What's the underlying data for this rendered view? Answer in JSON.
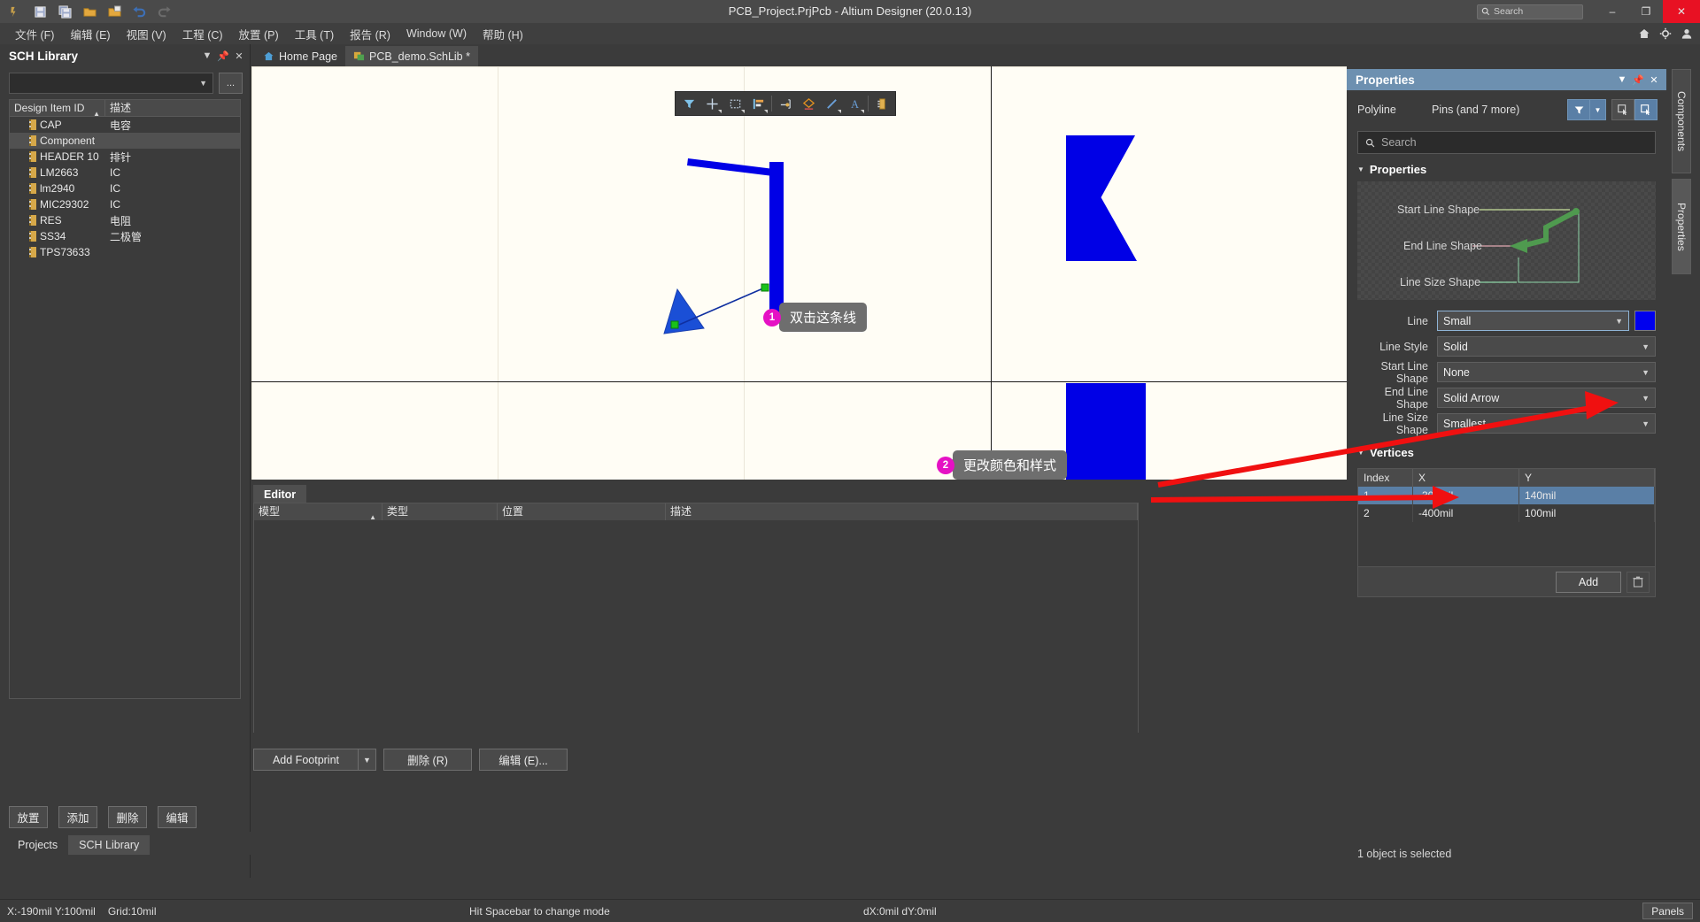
{
  "window": {
    "title": "PCB_Project.PrjPcb - Altium Designer (20.0.13)",
    "search_placeholder": "Search",
    "minimize": "–",
    "maximize": "❐",
    "close": "✕"
  },
  "quick_access": [
    {
      "name": "altium-logo-icon"
    },
    {
      "name": "save-icon"
    },
    {
      "name": "save-all-icon"
    },
    {
      "name": "open-icon"
    },
    {
      "name": "open-project-icon"
    },
    {
      "name": "undo-icon"
    },
    {
      "name": "redo-icon"
    }
  ],
  "menu": {
    "items": [
      {
        "label": "文件 (F)"
      },
      {
        "label": "编辑 (E)"
      },
      {
        "label": "视图 (V)"
      },
      {
        "label": "工程 (C)"
      },
      {
        "label": "放置 (P)"
      },
      {
        "label": "工具 (T)"
      },
      {
        "label": "报告 (R)"
      },
      {
        "label": "Window (W)"
      },
      {
        "label": "帮助 (H)"
      }
    ],
    "right_icons": [
      "home-icon",
      "gear-icon",
      "user-icon"
    ]
  },
  "sch_library": {
    "title": "SCH Library",
    "header_buttons": [
      "chevron-down-icon",
      "pin-icon",
      "close-icon"
    ],
    "combo_value": "",
    "ellipsis_label": "...",
    "columns": [
      "Design Item ID",
      "描述"
    ],
    "rows": [
      {
        "id": "CAP",
        "desc": "电容",
        "selected": false
      },
      {
        "id": "Component",
        "desc": "",
        "selected": true
      },
      {
        "id": "HEADER 10",
        "desc": "排针",
        "selected": false
      },
      {
        "id": "LM2663",
        "desc": "IC",
        "selected": false
      },
      {
        "id": "lm2940",
        "desc": "IC",
        "selected": false
      },
      {
        "id": "MIC29302",
        "desc": "IC",
        "selected": false
      },
      {
        "id": "RES",
        "desc": "电阻",
        "selected": false
      },
      {
        "id": "SS34",
        "desc": "二极管",
        "selected": false
      },
      {
        "id": "TPS73633",
        "desc": "",
        "selected": false
      }
    ],
    "buttons": [
      {
        "label": "放置"
      },
      {
        "label": "添加"
      },
      {
        "label": "删除"
      },
      {
        "label": "编辑"
      }
    ],
    "tabs": [
      {
        "label": "Projects",
        "active": false
      },
      {
        "label": "SCH Library",
        "active": true
      }
    ]
  },
  "document_tabs": [
    {
      "label": "Home Page",
      "icon": "home-icon",
      "active": false
    },
    {
      "label": "PCB_demo.SchLib *",
      "icon": "schlib-icon",
      "active": true
    }
  ],
  "canvas_toolbar": [
    {
      "name": "filter-icon",
      "caret": false
    },
    {
      "name": "crosshair-icon",
      "caret": true
    },
    {
      "name": "select-area-icon",
      "caret": true
    },
    {
      "name": "align-icon",
      "caret": true
    },
    {
      "name": "place-pin-icon",
      "caret": false
    },
    {
      "name": "place-polygon-icon",
      "caret": false
    },
    {
      "name": "place-line-icon",
      "caret": true
    },
    {
      "name": "place-text-icon",
      "caret": true
    },
    {
      "name": "place-component-icon",
      "caret": false
    }
  ],
  "callouts": [
    {
      "number": "1",
      "text": "双击这条线"
    },
    {
      "number": "2",
      "text": "更改颜色和样式"
    }
  ],
  "editor_panel": {
    "tab_label": "Editor",
    "columns": [
      "模型",
      "类型",
      "位置",
      "描述"
    ],
    "rows": [],
    "buttons": [
      {
        "label": "Add Footprint",
        "accel": "A",
        "split": true
      },
      {
        "label": "删除 (R)",
        "split": false
      },
      {
        "label": "编辑 (E)...",
        "split": false
      }
    ]
  },
  "properties_panel": {
    "title": "Properties",
    "header_buttons": [
      "chevron-down-icon",
      "pin-icon",
      "close-icon"
    ],
    "object_type": "Polyline",
    "scope": "Pins (and 7 more)",
    "filter_icon": "funnel-icon",
    "search_placeholder": "Search",
    "section_properties": "Properties",
    "preview_labels": [
      "Start Line Shape",
      "End Line Shape",
      "Line Size Shape"
    ],
    "fields": [
      {
        "label": "Line",
        "value": "Small",
        "focused": true,
        "has_color": true,
        "color": "#0000ee"
      },
      {
        "label": "Line Style",
        "value": "Solid",
        "focused": false,
        "has_color": false
      },
      {
        "label": "Start Line Shape",
        "value": "None",
        "focused": false,
        "has_color": false
      },
      {
        "label": "End Line Shape",
        "value": "Solid Arrow",
        "focused": false,
        "has_color": false
      },
      {
        "label": "Line Size Shape",
        "value": "Smallest",
        "focused": false,
        "has_color": false
      }
    ],
    "section_vertices": "Vertices",
    "vertices_columns": [
      "Index",
      "X",
      "Y"
    ],
    "vertices": [
      {
        "index": "1",
        "x": "-300mil",
        "y": "140mil",
        "selected": true
      },
      {
        "index": "2",
        "x": "-400mil",
        "y": "100mil",
        "selected": false
      }
    ],
    "add_label": "Add",
    "delete_icon": "trash-icon",
    "status": "1 object is selected"
  },
  "vertical_tabs": [
    {
      "label": "Components",
      "active": false
    },
    {
      "label": "Properties",
      "active": true
    }
  ],
  "statusbar": {
    "coords": "X:-190mil Y:100mil",
    "grid": "Grid:10mil",
    "hint": "Hit Spacebar to change mode",
    "delta": "dX:0mil dY:0mil",
    "panels": "Panels"
  }
}
